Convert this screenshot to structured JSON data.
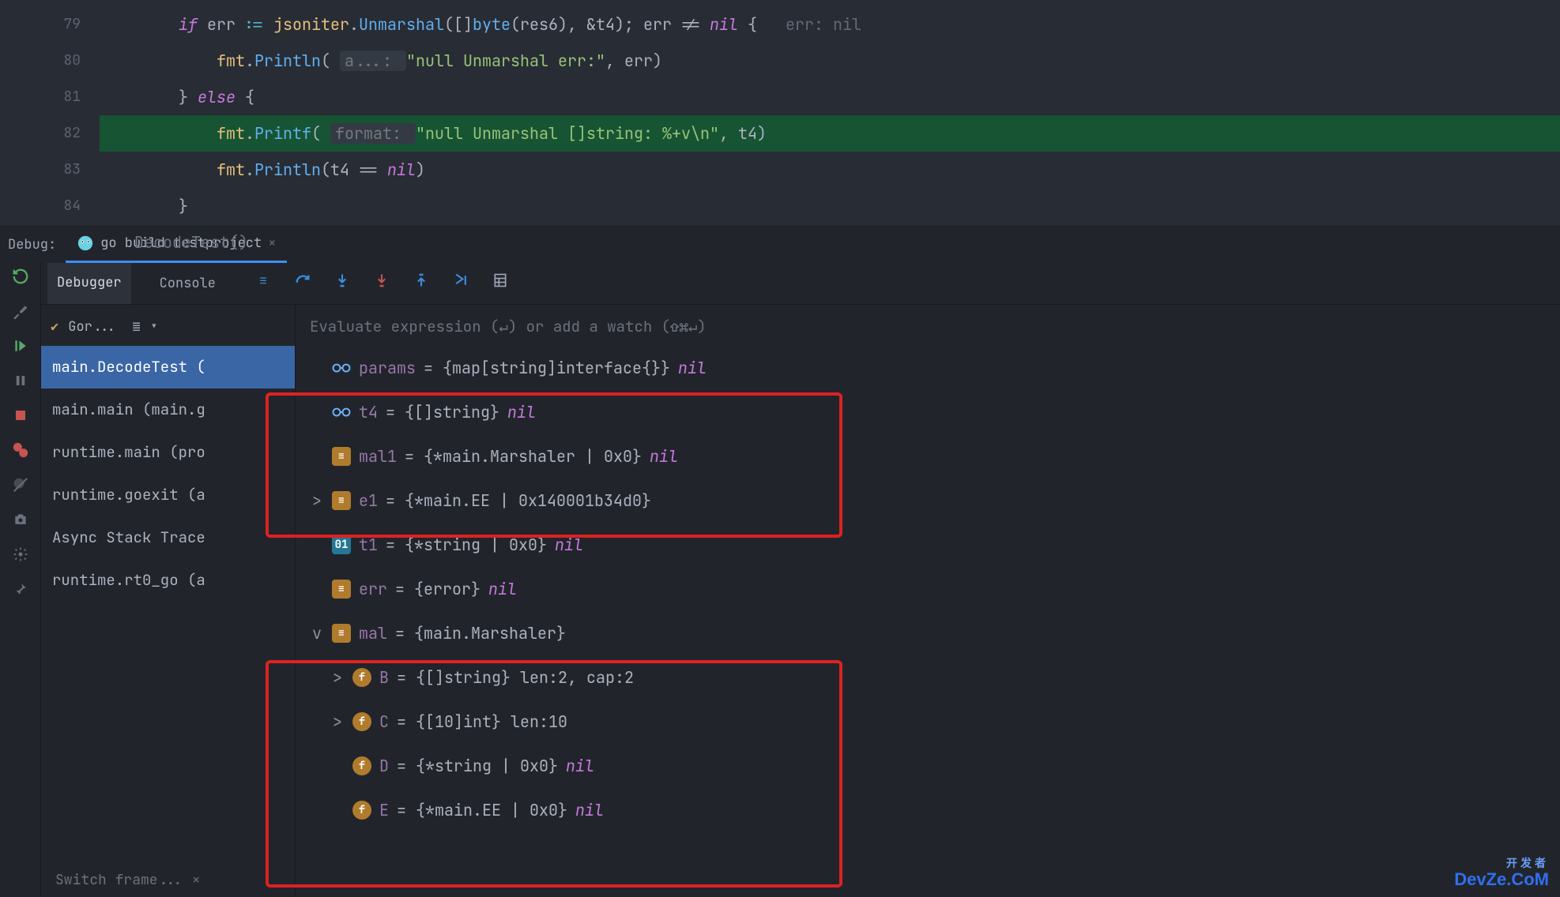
{
  "editor": {
    "lines": [
      {
        "num": "79",
        "indent": "        ",
        "tokens": [
          {
            "t": "if ",
            "c": "kw-if"
          },
          {
            "t": "err ",
            "c": "ident"
          },
          {
            "t": ":= ",
            "c": "op"
          },
          {
            "t": "jsoniter",
            "c": "pkg"
          },
          {
            "t": ".",
            "c": "paren"
          },
          {
            "t": "Unmarshal",
            "c": "func-call"
          },
          {
            "t": "([]",
            "c": "paren"
          },
          {
            "t": "byte",
            "c": "func-call"
          },
          {
            "t": "(res6), &t4); err != ",
            "c": "ident"
          },
          {
            "t": "nil",
            "c": "kw-nil"
          },
          {
            "t": " {   ",
            "c": "ident"
          },
          {
            "t": "err: nil",
            "c": "inlay"
          }
        ]
      },
      {
        "num": "80",
        "indent": "            ",
        "tokens": [
          {
            "t": "fmt",
            "c": "pkg"
          },
          {
            "t": ".",
            "c": "paren"
          },
          {
            "t": "Println",
            "c": "func-call"
          },
          {
            "t": "( ",
            "c": "paren"
          },
          {
            "t": "a...: ",
            "c": "hint"
          },
          {
            "t": "\"null Unmarshal err:\"",
            "c": "str"
          },
          {
            "t": ", err)",
            "c": "ident"
          }
        ]
      },
      {
        "num": "81",
        "indent": "        ",
        "tokens": [
          {
            "t": "} ",
            "c": "ident"
          },
          {
            "t": "else",
            "c": "kw-if"
          },
          {
            "t": " {",
            "c": "ident"
          }
        ]
      },
      {
        "num": "82",
        "indent": "            ",
        "hl": true,
        "tokens": [
          {
            "t": "fmt",
            "c": "pkg"
          },
          {
            "t": ".",
            "c": "paren"
          },
          {
            "t": "Printf",
            "c": "func-call"
          },
          {
            "t": "( ",
            "c": "paren"
          },
          {
            "t": "format: ",
            "c": "hint"
          },
          {
            "t": "\"null Unmarshal []string: %+v\\n\"",
            "c": "str"
          },
          {
            "t": ", t4)",
            "c": "ident"
          }
        ]
      },
      {
        "num": "83",
        "indent": "            ",
        "tokens": [
          {
            "t": "fmt",
            "c": "pkg"
          },
          {
            "t": ".",
            "c": "paren"
          },
          {
            "t": "Println",
            "c": "func-call"
          },
          {
            "t": "(t4 == ",
            "c": "ident"
          },
          {
            "t": "nil",
            "c": "kw-nil"
          },
          {
            "t": ")",
            "c": "ident"
          }
        ]
      },
      {
        "num": "84",
        "indent": "        ",
        "tokens": [
          {
            "t": "}",
            "c": "ident"
          }
        ]
      }
    ],
    "stack_hint": "DecodeTest()"
  },
  "debug": {
    "label": "Debug:",
    "tab": "go build testproject",
    "tabs": {
      "debugger": "Debugger",
      "console": "Console"
    },
    "frames_label": "Gor...",
    "eval_hint": "Evaluate expression (↵) or add a watch (⇧⌘↵)",
    "frames": [
      {
        "t": "main.DecodeTest (",
        "sel": true
      },
      {
        "t": "main.main (main.g"
      },
      {
        "t": "runtime.main (pro"
      },
      {
        "t": "runtime.goexit (a"
      },
      {
        "t": "Async Stack Trace"
      },
      {
        "t": "runtime.rt0_go (a"
      }
    ],
    "vars": [
      {
        "icon": "glasses",
        "name": "params",
        "val": "= {map[string]interface{}} ",
        "nil": "nil"
      },
      {
        "icon": "glasses",
        "name": "t4",
        "val": "= {[]string} ",
        "nil": "nil"
      },
      {
        "icon": "struct",
        "name": "mal1",
        "val": "= {*main.Marshaler | 0x0} ",
        "nil": "nil"
      },
      {
        "arrow": ">",
        "icon": "struct",
        "name": "e1",
        "val": "= {*main.EE | 0x140001b34d0}"
      },
      {
        "icon": "prim",
        "iconText": "01",
        "name": "t1",
        "val": "= {*string | 0x0} ",
        "nil": "nil"
      },
      {
        "icon": "struct",
        "name": "err",
        "val": "= {error} ",
        "nil": "nil"
      },
      {
        "arrow": "v",
        "icon": "struct",
        "name": "mal",
        "val": "= {main.Marshaler}"
      },
      {
        "indent": 1,
        "arrow": ">",
        "icon": "field",
        "iconText": "f",
        "name": "B",
        "val": "= {[]string} len:2, cap:2"
      },
      {
        "indent": 1,
        "arrow": ">",
        "icon": "field",
        "iconText": "f",
        "name": "C",
        "val": "= {[10]int} len:10"
      },
      {
        "indent": 1,
        "icon": "field",
        "iconText": "f",
        "name": "D",
        "val": "= {*string | 0x0} ",
        "nil": "nil"
      },
      {
        "indent": 1,
        "icon": "field",
        "iconText": "f",
        "name": "E",
        "val": "= {*main.EE | 0x0} ",
        "nil": "nil"
      }
    ],
    "switch_frame": "Switch frame..."
  },
  "watermark": {
    "top": "开发者",
    "bottom": "DevZe.CoM"
  }
}
